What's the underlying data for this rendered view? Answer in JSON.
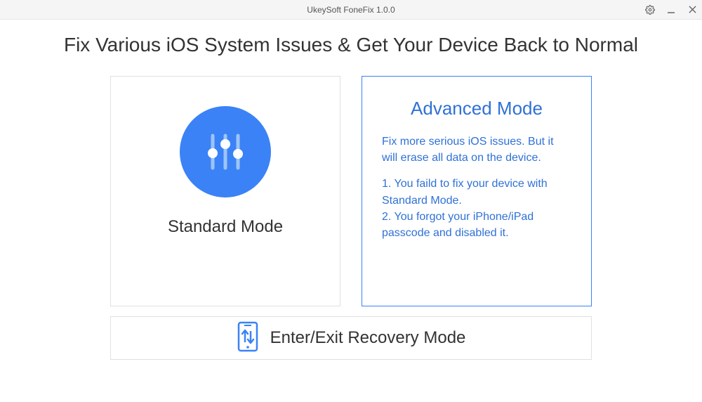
{
  "titlebar": {
    "title": "UkeySoft FoneFix 1.0.0"
  },
  "headline": "Fix Various iOS System Issues & Get Your Device Back to Normal",
  "standard": {
    "title": "Standard Mode"
  },
  "advanced": {
    "title": "Advanced Mode",
    "intro": "Fix more serious iOS issues. But it will erase all data on the device.",
    "point1": "1. You faild to fix your device with Standard Mode.",
    "point2": "2. You forgot your iPhone/iPad passcode and disabled it."
  },
  "recovery": {
    "label": "Enter/Exit Recovery Mode"
  }
}
